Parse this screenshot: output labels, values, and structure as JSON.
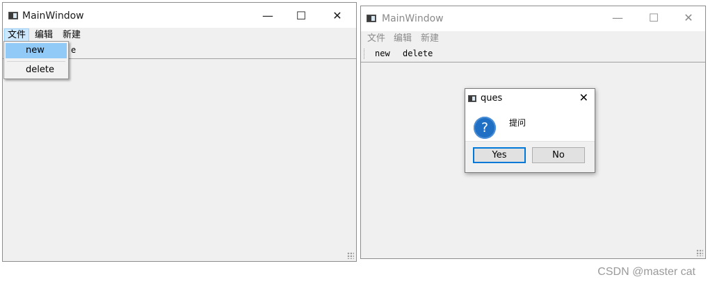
{
  "left_window": {
    "title": "MainWindow",
    "controls": {
      "minimize": "—",
      "maximize": "☐",
      "close": "✕"
    },
    "menu": [
      "文件",
      "编辑",
      "新建"
    ],
    "toolbar_visible_fragment": "e",
    "open_menu_items": [
      "new",
      "delete"
    ],
    "highlighted_item": "new"
  },
  "right_window": {
    "title": "MainWindow",
    "controls": {
      "minimize": "—",
      "maximize": "☐",
      "close": "✕"
    },
    "menu": [
      "文件",
      "编辑",
      "新建"
    ],
    "toolbar": [
      "new",
      "delete"
    ]
  },
  "dialog": {
    "title": "ques",
    "close": "✕",
    "icon": "question-icon",
    "icon_glyph": "?",
    "message": "提问",
    "buttons": [
      "Yes",
      "No"
    ],
    "default_button": "Yes"
  },
  "watermark": "CSDN @master cat"
}
